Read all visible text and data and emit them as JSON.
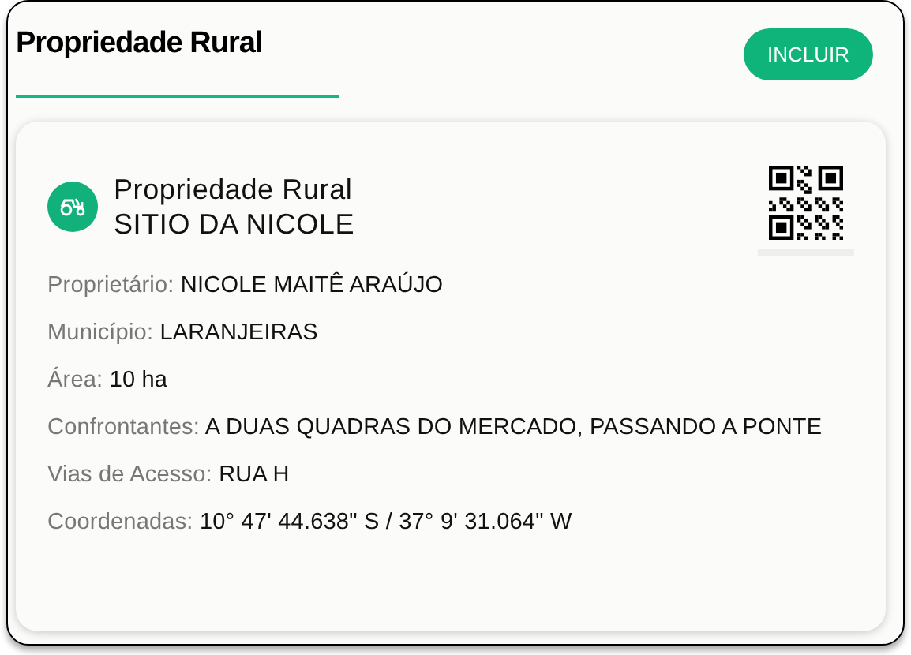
{
  "header": {
    "title": "Propriedade Rural",
    "button": "INCLUIR"
  },
  "card": {
    "type": "Propriedade Rural",
    "name": "SITIO DA NICOLE",
    "fields": [
      {
        "label": "Proprietário:",
        "value": "NICOLE MAITÊ ARAÚJO"
      },
      {
        "label": "Município:",
        "value": "LARANJEIRAS"
      },
      {
        "label": "Área:",
        "value": "10 ha"
      },
      {
        "label": "Confrontantes:",
        "value": "A DUAS QUADRAS DO MERCADO, PASSANDO A PONTE"
      },
      {
        "label": "Vias de Acesso:",
        "value": "RUA H"
      },
      {
        "label": "Coordenadas:",
        "value": "10° 47' 44.638\" S / 37° 9' 31.064\" W"
      }
    ]
  }
}
